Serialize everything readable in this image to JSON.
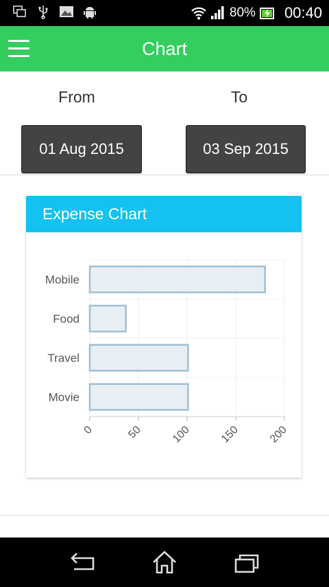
{
  "status_bar": {
    "battery_percent": "80%",
    "time": "00:40",
    "icons": [
      "screenshot-icon",
      "usb-icon",
      "image-icon",
      "android-icon",
      "wifi-icon",
      "signal-icon",
      "battery-charging-icon"
    ]
  },
  "app_bar": {
    "title": "Chart",
    "menu_icon": "hamburger-menu-icon"
  },
  "dates": {
    "from_label": "From",
    "to_label": "To",
    "from_value": "01 Aug 2015",
    "to_value": "03 Sep 2015"
  },
  "card": {
    "title": "Expense Chart"
  },
  "chart_data": {
    "type": "bar",
    "orientation": "horizontal",
    "categories": [
      "Mobile",
      "Food",
      "Travel",
      "Movie"
    ],
    "values": [
      180,
      37,
      101,
      101
    ],
    "xlim": [
      0,
      200
    ],
    "xticks": [
      0,
      50,
      100,
      150,
      200
    ],
    "grid": true,
    "bar_fill": "#e8eff4",
    "bar_stroke": "#9fbfd3"
  },
  "nav_bar": {
    "icons": [
      "back-icon",
      "home-icon",
      "recent-apps-icon"
    ]
  },
  "colors": {
    "app_bar": "#34ce5f",
    "card_header": "#13c2f0",
    "date_button": "#434343"
  }
}
